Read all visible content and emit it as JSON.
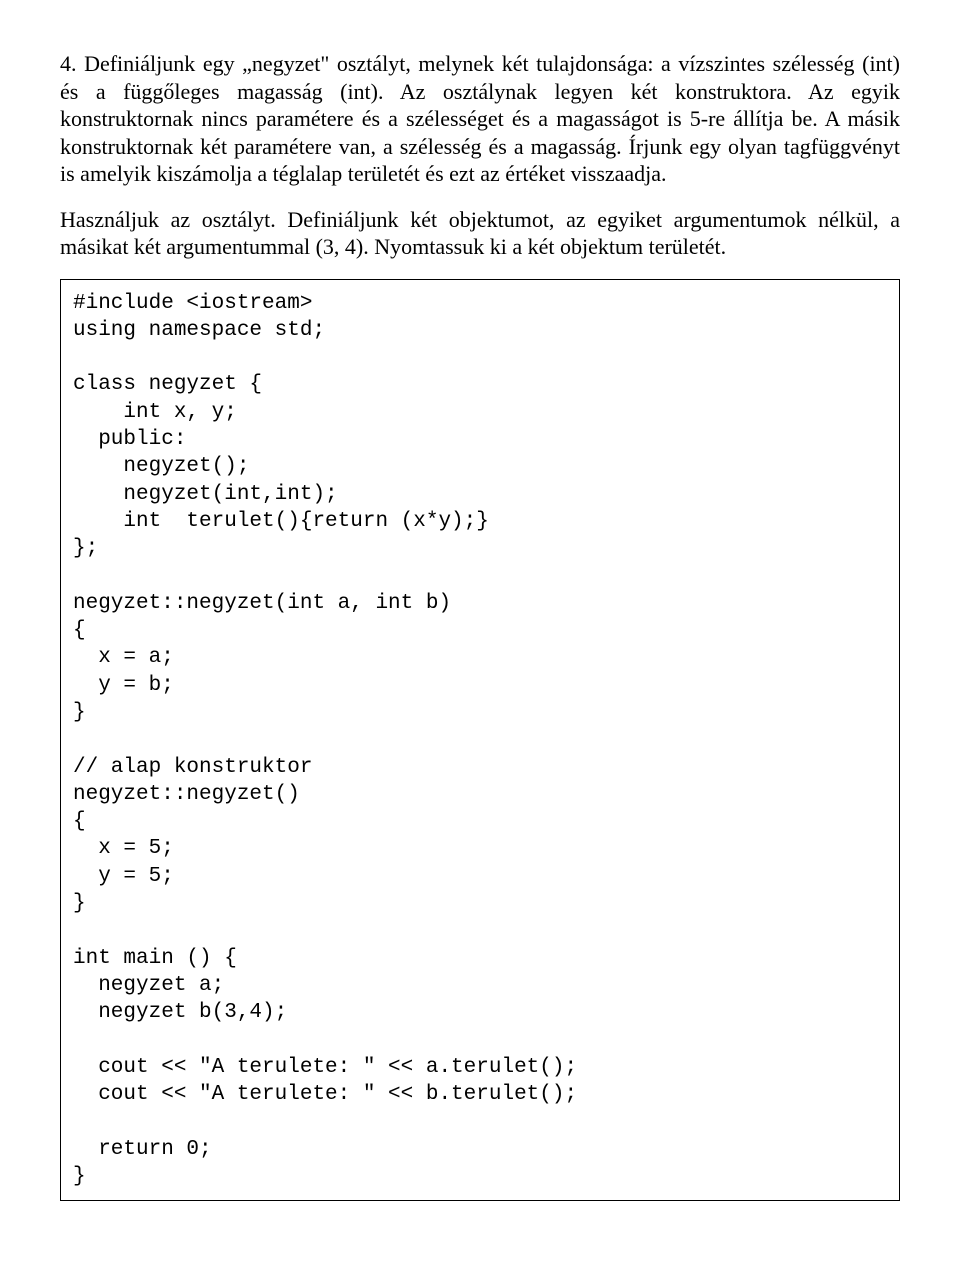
{
  "exercise": {
    "p1": "4. Definiáljunk egy „negyzet\" osztályt, melynek két tulajdonsága: a vízszintes szélesség (int) és a függőleges magasság (int). Az osztálynak legyen két konstruktora. Az egyik konstruktornak nincs paramétere és a szélességet és a magasságot is 5-re állítja be. A másik konstruktornak két paramétere van, a szélesség és a magasság. Írjunk egy olyan tagfüggvényt is amelyik kiszámolja a téglalap területét és ezt az értéket visszaadja.",
    "p2": "Használjuk az osztályt. Definiáljunk két objektumot, az egyiket argumentumok nélkül, a másikat két argumentummal (3, 4). Nyomtassuk ki a két objektum területét."
  },
  "code": "#include <iostream>\nusing namespace std;\n\nclass negyzet {\n    int x, y;\n  public:\n    negyzet();\n    negyzet(int,int);\n    int  terulet(){return (x*y);}\n};\n\nnegyzet::negyzet(int a, int b)\n{\n  x = a;\n  y = b;\n}\n\n// alap konstruktor\nnegyzet::negyzet()\n{\n  x = 5;\n  y = 5;\n}\n\nint main () {\n  negyzet a;\n  negyzet b(3,4);\n\n  cout << \"A terulete: \" << a.terulet();\n  cout << \"A terulete: \" << b.terulet();\n\n  return 0;\n}"
}
